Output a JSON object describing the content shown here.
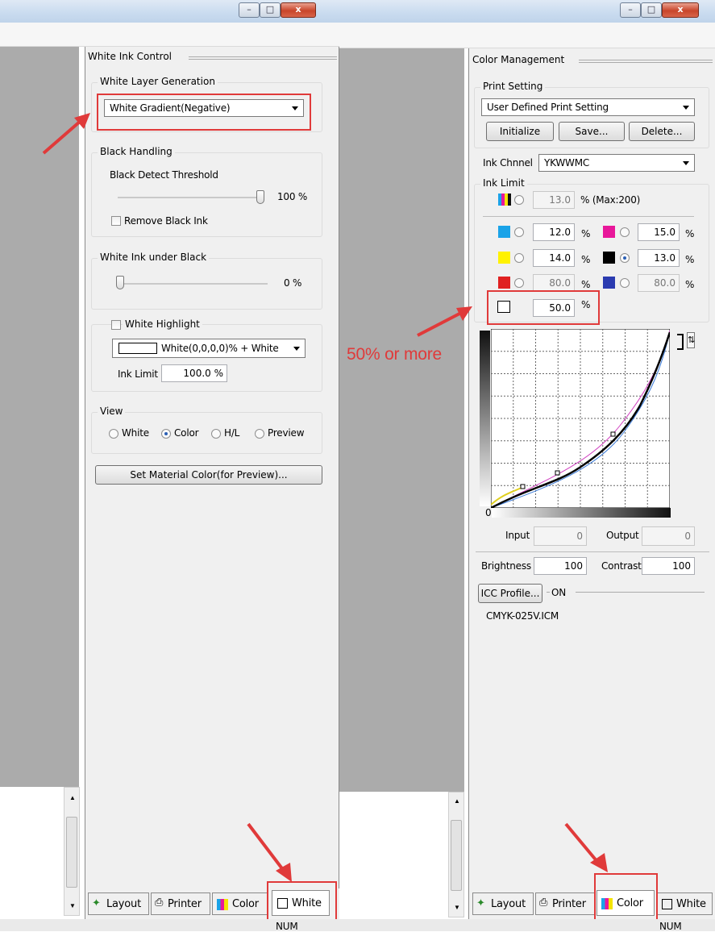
{
  "left": {
    "panel_title": "White Ink Control",
    "white_layer": {
      "legend": "White Layer Generation",
      "selected": "White Gradient(Negative)"
    },
    "black_handling": {
      "legend": "Black Handling",
      "threshold_label": "Black Detect Threshold",
      "threshold_value": "100 %",
      "remove_black_label": "Remove Black Ink"
    },
    "white_under_black": {
      "legend": "White Ink under Black",
      "value": "0 %"
    },
    "white_highlight": {
      "label": "White Highlight",
      "selected": "White(0,0,0,0)% + White",
      "ink_limit_label": "Ink Limit",
      "ink_limit_value": "100.0 %"
    },
    "view": {
      "legend": "View",
      "options": [
        "White",
        "Color",
        "H/L",
        "Preview"
      ],
      "selected": "Color"
    },
    "material_button": "Set Material Color(for Preview)...",
    "tabs": [
      "Layout",
      "Printer",
      "Color",
      "White"
    ],
    "active_tab": "White",
    "status": "NUM"
  },
  "right": {
    "panel_title": "Color Management",
    "print_setting": {
      "legend": "Print Setting",
      "selected": "User Defined Print Setting",
      "buttons": [
        "Initialize",
        "Save...",
        "Delete..."
      ]
    },
    "ink_channel": {
      "label": "Ink Chnnel",
      "value": "YKWWMC"
    },
    "ink_limit": {
      "legend": "Ink Limit",
      "total": "13.0",
      "total_unit": "% (Max:200)",
      "pct": "%",
      "c": "12.0",
      "m": "15.0",
      "y": "14.0",
      "k": "13.0",
      "r": "80.0",
      "b": "80.0",
      "w": "50.0"
    },
    "curve": {
      "zero_label": "0",
      "input_label": "Input",
      "input_value": "0",
      "output_label": "Output",
      "output_value": "0"
    },
    "brightness_label": "Brightness",
    "brightness_value": "100",
    "contrast_label": "Contrast",
    "contrast_value": "100",
    "icc_button": "ICC Profile...",
    "icc_state": "ON",
    "icc_file": "CMYK-025V.ICM",
    "tabs": [
      "Layout",
      "Printer",
      "Color",
      "White"
    ],
    "active_tab": "Color",
    "status": "NUM"
  },
  "annotation": {
    "note": "50% or more",
    "color": "#e03a3a"
  },
  "colors": {
    "cyan": "#1aa3e8",
    "magenta": "#e8179a",
    "yellow": "#fff200",
    "black": "#000000",
    "red": "#e02020",
    "blue": "#2b3bb0"
  }
}
